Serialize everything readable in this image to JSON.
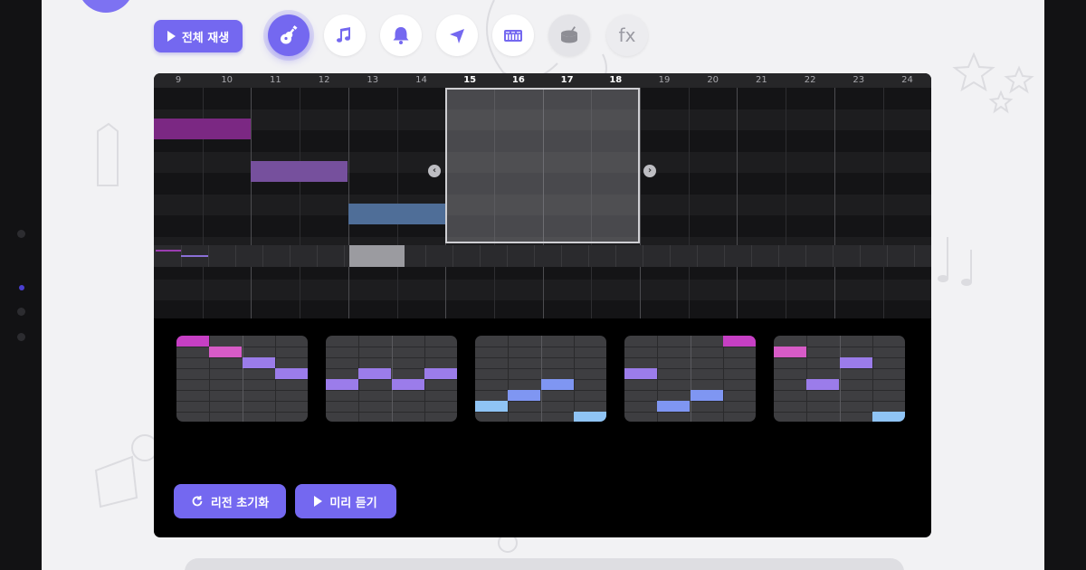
{
  "toolbar": {
    "play_all_label": "전체 재생",
    "instruments": [
      {
        "icon": "guitar-icon",
        "active": true
      },
      {
        "icon": "music-notes-icon",
        "active": false
      },
      {
        "icon": "bell-icon",
        "active": false
      },
      {
        "icon": "conductor-baton-icon",
        "active": false
      },
      {
        "icon": "keyboard-icon",
        "active": false
      },
      {
        "icon": "drum-icon",
        "active": false
      },
      {
        "icon": "fx-icon",
        "label": "fx",
        "active": false
      }
    ]
  },
  "timeline": {
    "measures": [
      "9",
      "10",
      "11",
      "12",
      "13",
      "14",
      "15",
      "16",
      "17",
      "18",
      "19",
      "20",
      "21",
      "22",
      "23",
      "24"
    ],
    "selected_measures": [
      "15",
      "16",
      "17",
      "18"
    ]
  },
  "actions": {
    "reset_region_label": "리전 초기화",
    "preview_label": "미리 듣기"
  },
  "colors": {
    "accent": "#7468f0",
    "note_magenta": "#c63fc4",
    "note_pink": "#d75bc7",
    "note_violet": "#9b7cea",
    "note_blue": "#7f96f2",
    "note_cyan": "#8fc4f5"
  }
}
